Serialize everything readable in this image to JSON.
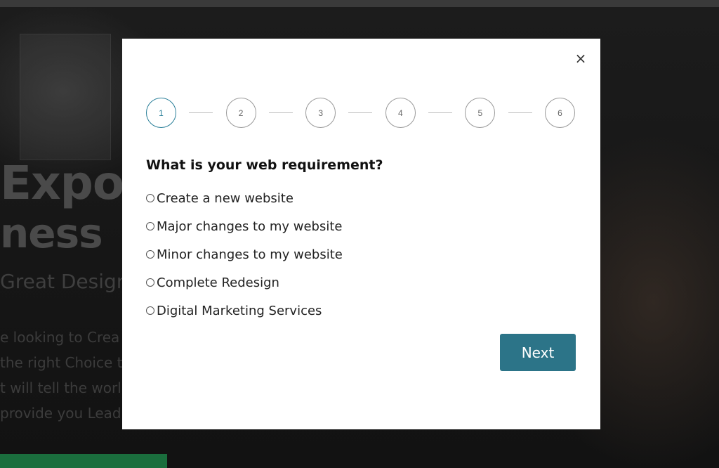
{
  "background": {
    "hero_line1": "Expos",
    "hero_line2": "ness",
    "subtitle": "Great Design",
    "text_lines": [
      "e looking to Crea",
      "the right Choice t",
      "t will tell the worl",
      "provide you Lead"
    ]
  },
  "modal": {
    "close_glyph": "×",
    "steps": [
      "1",
      "2",
      "3",
      "4",
      "5",
      "6"
    ],
    "active_step": "1",
    "question": "What is your web requirement?",
    "options": [
      "Create a new website",
      "Major changes to my website",
      "Minor changes to my website",
      "Complete Redesign",
      "Digital Marketing Services"
    ],
    "next_label": "Next"
  },
  "colors": {
    "accent": "#2c7488",
    "active_step": "#2a7f99",
    "overlay": "#111111"
  },
  "icons": {
    "close": "close-icon",
    "radio": "radio-unselected"
  }
}
